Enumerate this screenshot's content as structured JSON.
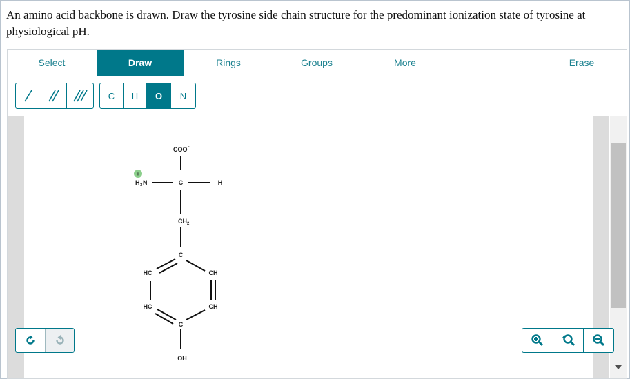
{
  "question": "An amino acid backbone is drawn. Draw the tyrosine side chain structure for the predominant ionization state of tyrosine at physiological pH.",
  "tabs": [
    {
      "label": "Select",
      "active": false
    },
    {
      "label": "Draw",
      "active": true
    },
    {
      "label": "Rings",
      "active": false
    },
    {
      "label": "Groups",
      "active": false
    },
    {
      "label": "More",
      "active": false
    },
    {
      "label": "Erase",
      "active": false
    }
  ],
  "bond_tools": [
    "single-bond",
    "double-bond",
    "triple-bond"
  ],
  "atom_tools": [
    {
      "label": "C",
      "active": false
    },
    {
      "label": "H",
      "active": false
    },
    {
      "label": "O",
      "active": true
    },
    {
      "label": "N",
      "active": false
    }
  ],
  "molecule": {
    "carboxylate": "COO",
    "carboxylate_charge": "-",
    "amine": "H",
    "amine_sub": "3",
    "amine_atom": "N",
    "amine_charge": "+",
    "alpha_carbon": "C",
    "alpha_h": "H",
    "methylene": "CH",
    "methylene_sub": "2",
    "ring_top": "C",
    "ring_upper_left": "HC",
    "ring_upper_right": "CH",
    "ring_lower_left": "HC",
    "ring_lower_right": "CH",
    "ring_bottom": "C",
    "hydroxyl": "OH"
  },
  "history": {
    "undo": "undo",
    "redo": "redo",
    "redo_disabled": true
  },
  "zoom_tools": [
    "zoom-in",
    "zoom-reset",
    "zoom-out"
  ],
  "colors": {
    "accent": "#00788a",
    "charge_badge": "#8ccf8c"
  }
}
